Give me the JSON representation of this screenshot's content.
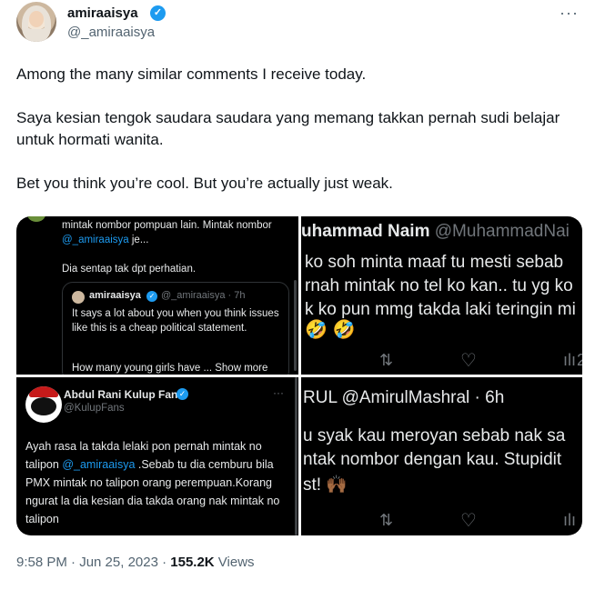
{
  "author": {
    "name": "amiraaisya",
    "handle": "@_amiraaisya",
    "verified_badge": "✓",
    "more": "···"
  },
  "tweet": {
    "p1": "Among the many similar comments I receive today.",
    "p2": "Saya kesian tengok saudara saudara yang memang takkan pernah sudi belajar untuk hormati wanita.",
    "p3": "Bet you think you’re cool. But you’re actually just weak."
  },
  "media": {
    "panel1": {
      "line1": "mintak nombor pompuan lain. Mintak nombor",
      "mention": "@_amiraaisya",
      "line2_rest": " je...",
      "line3": "Dia sentap tak dpt perhatian.",
      "quote": {
        "name": "amiraaisya",
        "handle": "@_amiraaisya · 7h",
        "text": "It says a lot about you when you think issues like this is a cheap political statement.",
        "more": "How many young girls have ... Show more"
      }
    },
    "panel2": {
      "name": "uhammad Naim",
      "handle": "@MuhammadNai",
      "line1": "ko soh minta maaf tu mesti sebab",
      "line2": "rnah mintak no tel ko kan.. tu yg ko",
      "line3": "k ko pun mmg takda laki teringin mi",
      "emoji": "🤣 🤣",
      "reply_icon": "⇅",
      "like_icon": "♡",
      "views_icon": "ılı",
      "views_count": "2"
    },
    "panel3": {
      "name": "Abdul Rani Kulup Fans",
      "handle": "@KulupFans",
      "more": "···",
      "text_before": "Ayah rasa la takda lelaki pon pernah mintak no talipon ",
      "mention": "@_amiraaisya",
      "text_after": " .Sebab tu dia cemburu bila PMX mintak no talipon orang perempuan.Korang ngurat la dia kesian dia takda orang nak mintak no talipon"
    },
    "panel4": {
      "header": "RUL @AmirulMashral · 6h",
      "line1": "u syak kau meroyan sebab nak sa",
      "line2": "ntak nombor dengan kau. Stupidit",
      "line3": "st! 🙌🏾",
      "reply_icon": "⇅",
      "like_icon": "♡",
      "views_icon": "ılı"
    }
  },
  "meta": {
    "time": "9:58 PM · Jun 25, 2023 · ",
    "views_count": "155.2K",
    "views_label": " Views"
  }
}
